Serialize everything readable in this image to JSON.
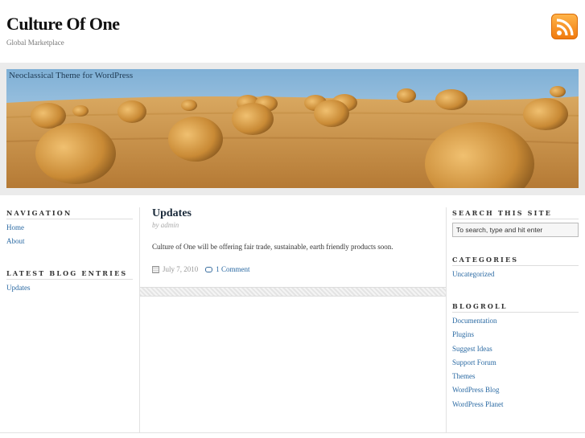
{
  "header": {
    "site_title": "Culture Of One",
    "tagline": "Global Marketplace",
    "rss_icon": "rss-icon"
  },
  "banner": {
    "caption": "Neoclassical Theme for WordPress",
    "sky_color": "#9ec3dc",
    "field_color": "#c9954a"
  },
  "left_sidebar": {
    "navigation": {
      "heading": "Navigation",
      "items": [
        {
          "label": "Home"
        },
        {
          "label": "About"
        }
      ]
    },
    "latest": {
      "heading": "Latest Blog Entries",
      "items": [
        {
          "label": "Updates"
        }
      ]
    }
  },
  "post": {
    "title": "Updates",
    "byline": "by admin",
    "body": "Culture of One will be offering fair trade, sustainable, earth friendly products soon.",
    "date": "July 7, 2010",
    "comments": "1 Comment"
  },
  "right_sidebar": {
    "search": {
      "heading": "Search This Site",
      "placeholder": "To search, type and hit enter"
    },
    "categories": {
      "heading": "Categories",
      "items": [
        {
          "label": "Uncategorized"
        }
      ]
    },
    "blogroll": {
      "heading": "Blogroll",
      "items": [
        {
          "label": "Documentation"
        },
        {
          "label": "Plugins"
        },
        {
          "label": "Suggest Ideas"
        },
        {
          "label": "Support Forum"
        },
        {
          "label": "Themes"
        },
        {
          "label": "WordPress Blog"
        },
        {
          "label": "WordPress Planet"
        }
      ]
    }
  },
  "colors": {
    "link": "#2b6aa3",
    "title": "#111111",
    "rss_orange": "#f39a1e"
  }
}
